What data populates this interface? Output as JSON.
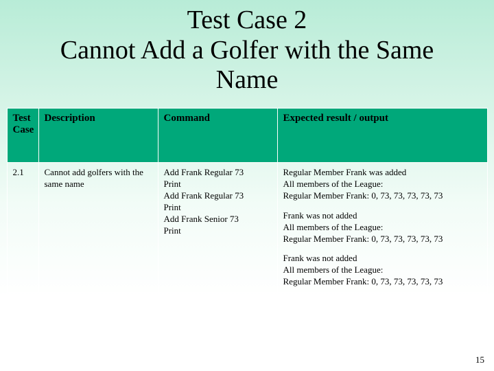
{
  "title_lines": [
    "Test Case 2",
    "Cannot Add a Golfer with the Same",
    "Name"
  ],
  "table": {
    "headers": {
      "test_case": "Test Case",
      "description": "Description",
      "command": "Command",
      "expected": "Expected result / output"
    },
    "row": {
      "test_case": "2.1",
      "description": "Cannot add golfers with the same name",
      "command_lines": [
        "Add Frank Regular 73",
        "Print",
        "Add Frank Regular 73",
        "Print",
        "Add Frank Senior 73",
        "Print"
      ],
      "expected_blocks": [
        [
          "Regular Member Frank was added",
          "All members of the League:",
          "Regular Member Frank: 0, 73, 73, 73, 73, 73"
        ],
        [
          "Frank was not added",
          "All members of the League:",
          "Regular Member Frank: 0, 73, 73, 73, 73, 73"
        ],
        [
          "Frank was not added",
          "All members of the League:",
          "Regular Member Frank: 0, 73, 73, 73, 73, 73"
        ]
      ]
    }
  },
  "page_number": "15"
}
